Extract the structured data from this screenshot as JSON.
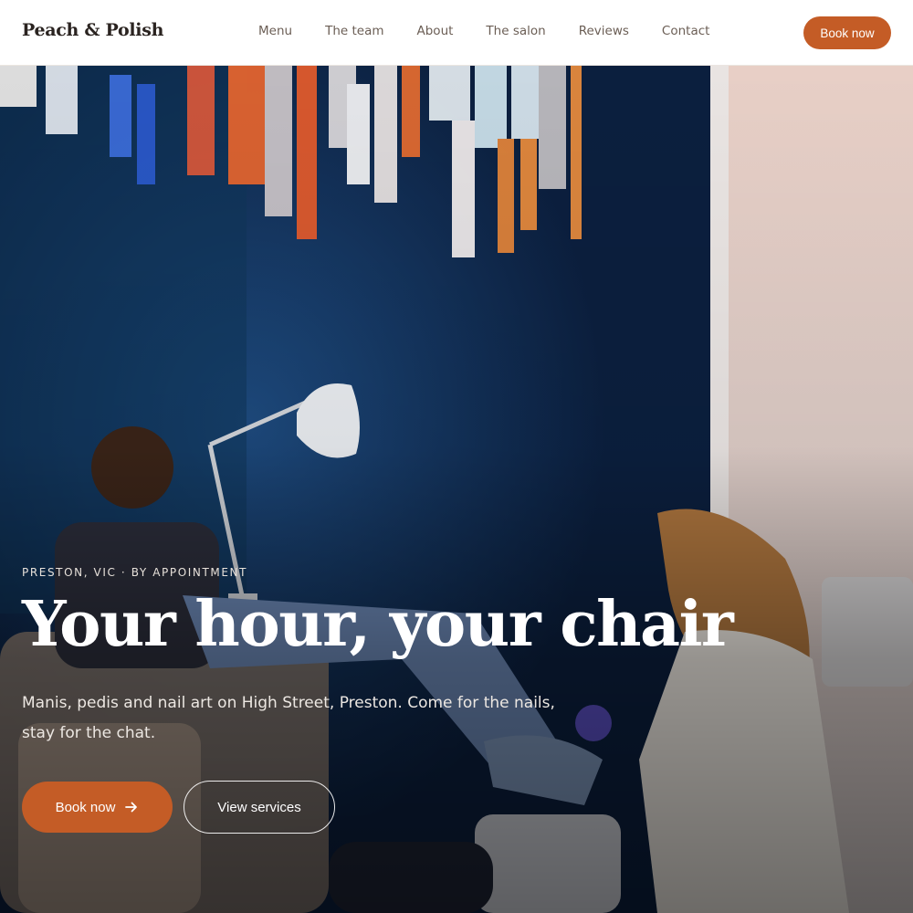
{
  "header": {
    "logo": "Peach & Polish",
    "nav": [
      "Menu",
      "The team",
      "About",
      "The salon",
      "Reviews",
      "Contact"
    ],
    "book_label": "Book now"
  },
  "hero": {
    "eyebrow": "PRESTON, VIC · BY APPOINTMENT",
    "headline": "Your hour, your chair",
    "subtext": "Manis, pedis and nail art on High Street, Preston. Come for the nails, stay for the chat.",
    "primary_cta": "Book now",
    "primary_cta_icon": "arrow-right-icon",
    "secondary_cta": "View services"
  },
  "colors": {
    "accent": "#c45c26",
    "hero_wall": "#0f2a50"
  }
}
